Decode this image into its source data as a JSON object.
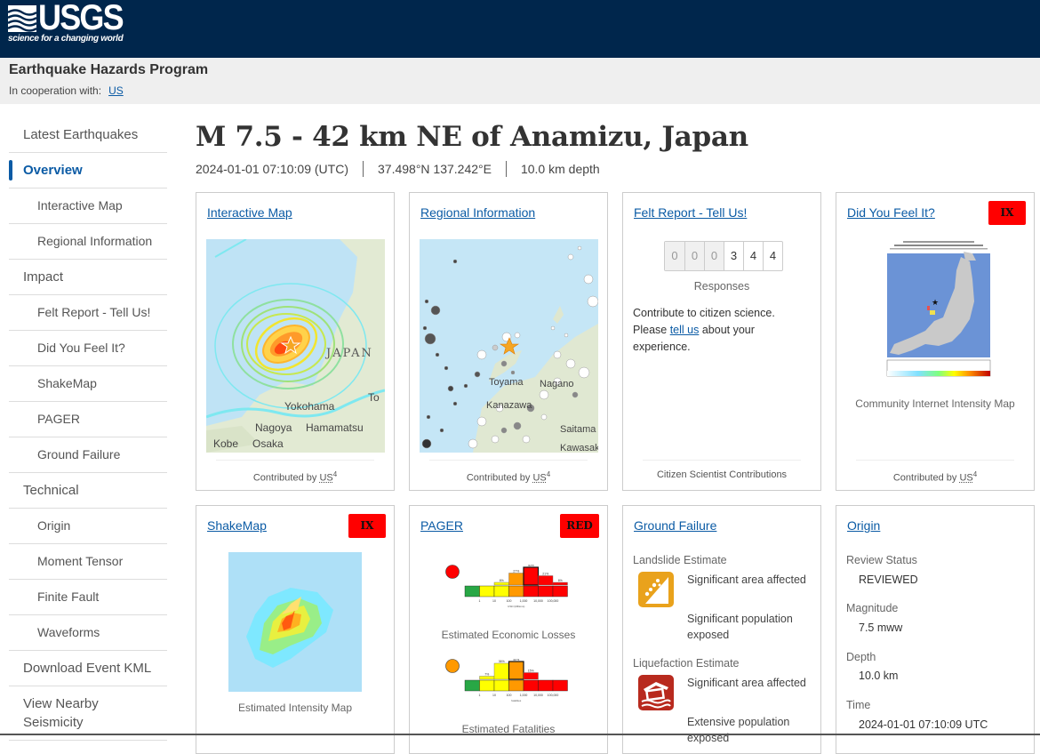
{
  "header": {
    "logo_text": "USGS",
    "logo_tagline": "science for a changing world",
    "program_title": "Earthquake Hazards Program",
    "cooperation_label": "In cooperation with:",
    "cooperation_link": "US",
    "background_color": "#00264c"
  },
  "sidebar": {
    "items": [
      {
        "label": "Latest Earthquakes",
        "level": "top"
      },
      {
        "label": "Overview",
        "level": "top",
        "active": true
      },
      {
        "label": "Interactive Map",
        "level": "sub"
      },
      {
        "label": "Regional Information",
        "level": "sub"
      },
      {
        "label": "Impact",
        "level": "top"
      },
      {
        "label": "Felt Report - Tell Us!",
        "level": "sub"
      },
      {
        "label": "Did You Feel It?",
        "level": "sub"
      },
      {
        "label": "ShakeMap",
        "level": "sub"
      },
      {
        "label": "PAGER",
        "level": "sub"
      },
      {
        "label": "Ground Failure",
        "level": "sub"
      },
      {
        "label": "Technical",
        "level": "top"
      },
      {
        "label": "Origin",
        "level": "sub"
      },
      {
        "label": "Moment Tensor",
        "level": "sub"
      },
      {
        "label": "Finite Fault",
        "level": "sub"
      },
      {
        "label": "Waveforms",
        "level": "sub"
      },
      {
        "label": "Download Event KML",
        "level": "top"
      },
      {
        "label": "View Nearby Seismicity",
        "level": "top"
      }
    ]
  },
  "event": {
    "title": "M 7.5 - 42 km NE of Anamizu, Japan",
    "time": "2024-01-01 07:10:09 (UTC)",
    "location": "37.498°N 137.242°E",
    "depth": "10.0 km depth"
  },
  "cards": {
    "interactive_map": {
      "title": "Interactive Map",
      "footer_prefix": "Contributed by",
      "footer_source": "US",
      "footer_sup": "4",
      "map_labels": [
        "JAPAN",
        "Yokohama",
        "Nagoya",
        "Hamamatsu",
        "Kobe",
        "Osaka",
        "To"
      ]
    },
    "regional_info": {
      "title": "Regional Information",
      "footer_prefix": "Contributed by",
      "footer_source": "US",
      "footer_sup": "4",
      "map_labels": [
        "Toyama",
        "Nagano",
        "Kanazawa",
        "Saitama",
        "Kawasaki"
      ]
    },
    "felt_report": {
      "title": "Felt Report - Tell Us!",
      "digits": [
        "0",
        "0",
        "0",
        "3",
        "4",
        "4"
      ],
      "responses_label": "Responses",
      "text_before": "Contribute to citizen science. Please ",
      "link_text": "tell us",
      "text_after": " about your experience.",
      "footer": "Citizen Scientist Contributions"
    },
    "dyfi": {
      "title": "Did You Feel It?",
      "badge": "IX",
      "caption": "Community Internet Intensity Map",
      "footer_prefix": "Contributed by",
      "footer_source": "US",
      "footer_sup": "4"
    },
    "shakemap": {
      "title": "ShakeMap",
      "badge": "IX",
      "caption": "Estimated Intensity Map"
    },
    "pager": {
      "title": "PAGER",
      "badge": "RED",
      "losses_caption": "Estimated Economic Losses",
      "fatalities_caption": "Estimated Fatalities",
      "losses_alert_color": "#ff0000",
      "fatalities_alert_color": "#ff9900"
    },
    "ground_failure": {
      "title": "Ground Failure",
      "landslide_label": "Landslide Estimate",
      "landslide_area": "Significant area affected",
      "landslide_population": "Significant population exposed",
      "landslide_color": "#e9a21c",
      "liquefaction_label": "Liquefaction Estimate",
      "liquefaction_area": "Significant area affected",
      "liquefaction_population": "Extensive population exposed",
      "liquefaction_color": "#b82a1e"
    },
    "origin": {
      "title": "Origin",
      "review_status_label": "Review Status",
      "review_status": "REVIEWED",
      "magnitude_label": "Magnitude",
      "magnitude": "7.5 mww",
      "depth_label": "Depth",
      "depth": "10.0 km",
      "time_label": "Time",
      "time": "2024-01-01 07:10:09 UTC"
    }
  },
  "chart_data": [
    {
      "type": "bar",
      "title": "Estimated Economic Losses",
      "xlabel": "USD (Millions)",
      "categories": [
        "<1",
        "1-10",
        "10-100",
        "100-1,000",
        "1,000-10,000",
        "10,000-100,000",
        ">100,000"
      ],
      "tick_labels": [
        "1",
        "10",
        "100",
        "1,000",
        "10,000",
        "100,000"
      ],
      "values": [
        0,
        0,
        6,
        27,
        40,
        21,
        6
      ],
      "unit": "%",
      "colors": [
        "#28a745",
        "#ffff00",
        "#ffff00",
        "#ff9900",
        "#ff0000",
        "#ff0000",
        "#ff0000"
      ]
    },
    {
      "type": "bar",
      "title": "Estimated Fatalities",
      "xlabel": "fatalities",
      "categories": [
        "<1",
        "1-10",
        "10-100",
        "100-1,000",
        "1,000-10,000",
        "10,000-100,000",
        ">100,000"
      ],
      "tick_labels": [
        "1",
        "10",
        "100",
        "1,000",
        "10,000",
        "100,000"
      ],
      "values": [
        0,
        7,
        36,
        40,
        15,
        0,
        0
      ],
      "unit": "%",
      "colors": [
        "#28a745",
        "#ffff00",
        "#ffff00",
        "#ff9900",
        "#ff0000",
        "#ff0000",
        "#ff0000"
      ]
    }
  ]
}
